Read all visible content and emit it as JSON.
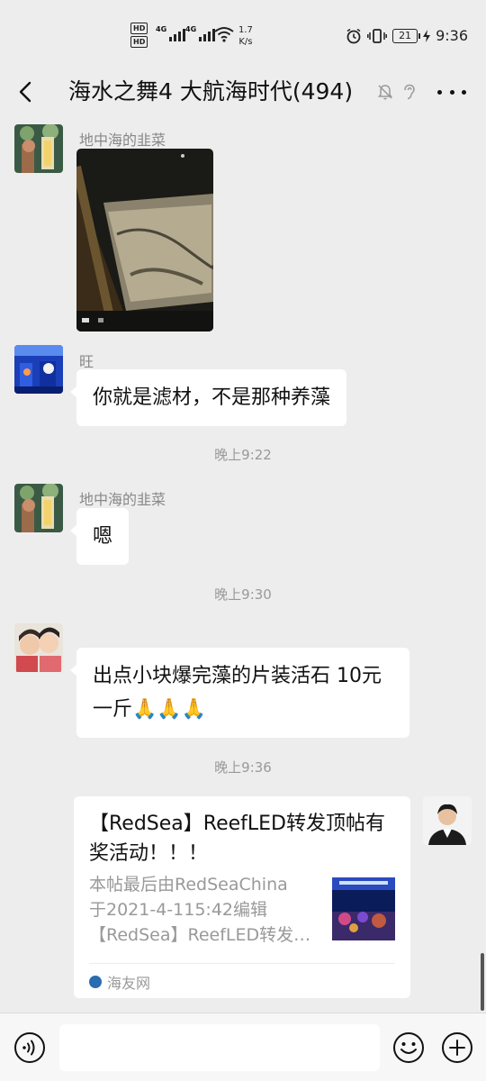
{
  "status_bar": {
    "hd1": "HD",
    "hd2": "HD",
    "net1": "4G",
    "net2": "4G",
    "speed_value": "1.7",
    "speed_unit": "K/s",
    "battery": "21",
    "time": "9:36"
  },
  "header": {
    "title": "海水之舞4 大航海时代(494)"
  },
  "messages": [
    {
      "sender": "地中海的韭菜",
      "type": "image"
    },
    {
      "sender": "旺",
      "text": "你就是滤材，不是那种养藻"
    },
    {
      "timestamp": "晚上9:22"
    },
    {
      "sender": "地中海的韭菜",
      "text": "嗯"
    },
    {
      "timestamp": "晚上9:30"
    },
    {
      "text": "出点小块爆完藻的片装活石 10元一斤🙏🙏🙏"
    },
    {
      "timestamp": "晚上9:36"
    },
    {
      "type": "link_card",
      "title": "【RedSea】ReefLED转发顶帖有奖活动！！！",
      "description": "本帖最后由RedSeaChina\n于2021-4-115:42编辑\n【RedSea】ReefLED转发…",
      "source": "海友网"
    }
  ],
  "input_bar": {
    "placeholder": ""
  },
  "icons": [
    "back-arrow-icon",
    "mute-bell-icon",
    "earpiece-icon",
    "more-icon",
    "voice-icon",
    "emoji-icon",
    "plus-icon"
  ],
  "colors": {
    "background": "#ededed",
    "bubble": "#ffffff",
    "timestamp": "#999999"
  }
}
